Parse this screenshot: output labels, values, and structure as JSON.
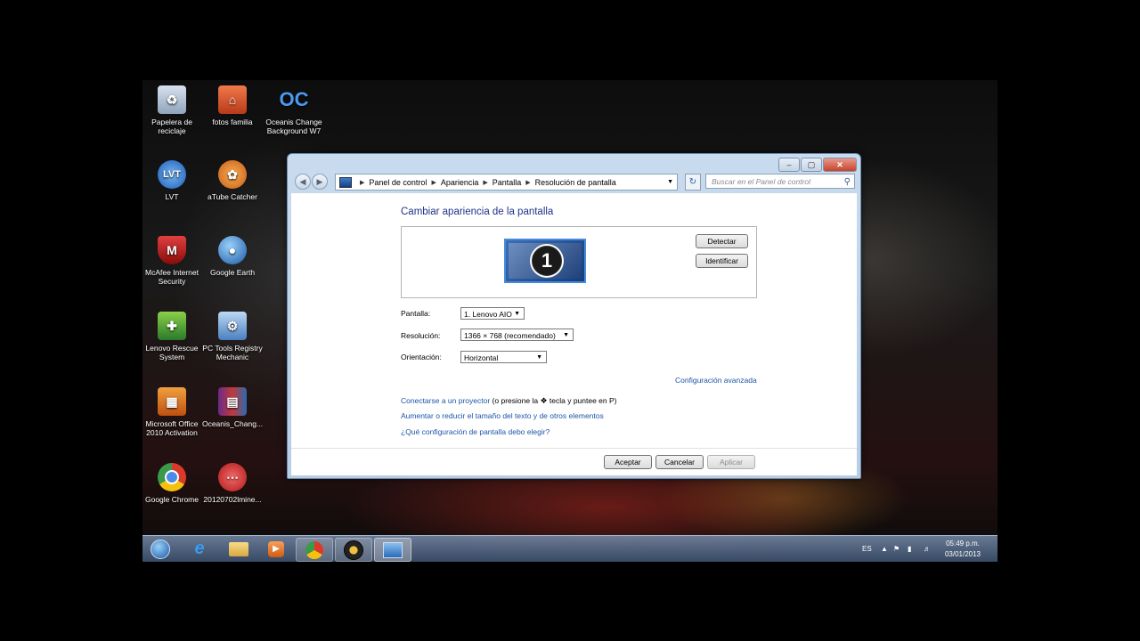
{
  "desktop_icons": [
    {
      "label": "Papelera de reciclaje",
      "icon": "recycle-bin-icon",
      "color": "#9ab0c8"
    },
    {
      "label": "fotos familia",
      "icon": "folder-home-icon",
      "color": "#d24a2a"
    },
    {
      "label": "Oceanis Change Background W7",
      "icon": "oceanis-icon",
      "color": "#3a7bd5"
    },
    {
      "label": "LVT",
      "icon": "lvt-icon",
      "color": "#2a6ec8"
    },
    {
      "label": "aTube Catcher",
      "icon": "atube-catcher-icon",
      "color": "#e07a1a"
    },
    {
      "label": "McAfee Internet Security",
      "icon": "mcafee-icon",
      "color": "#b01818"
    },
    {
      "label": "Google Earth",
      "icon": "google-earth-icon",
      "color": "#2a7ad0"
    },
    {
      "label": "Lenovo Rescue System",
      "icon": "lenovo-rescue-icon",
      "color": "#3a9a3a"
    },
    {
      "label": "PC Tools Registry Mechanic",
      "icon": "registry-mechanic-icon",
      "color": "#4a8ad0"
    },
    {
      "label": "Microsoft Office 2010 Activation",
      "icon": "office-activation-icon",
      "color": "#e08020"
    },
    {
      "label": "Oceanis_Chang...",
      "icon": "winrar-icon",
      "color": "#8a3a9a"
    },
    {
      "label": "Google Chrome",
      "icon": "chrome-icon",
      "color": "#d8322a"
    },
    {
      "label": "20120702lmine...",
      "icon": "lmine-icon",
      "color": "#d02828"
    }
  ],
  "window": {
    "breadcrumb": [
      "Panel de control",
      "Apariencia",
      "Pantalla",
      "Resolución de pantalla"
    ],
    "search_placeholder": "Buscar en el Panel de control",
    "heading": "Cambiar apariencia de la pantalla",
    "monitor_number": "1",
    "detect_button": "Detectar",
    "identify_button": "Identificar",
    "display_label": "Pantalla:",
    "display_value": "1. Lenovo AIO",
    "resolution_label": "Resolución:",
    "resolution_value": "1366 × 768 (recomendado)",
    "orientation_label": "Orientación:",
    "orientation_value": "Horizontal",
    "advanced_link": "Configuración avanzada",
    "projector_link": "Conectarse a un proyector",
    "projector_text_before": "(o presione la",
    "projector_text_after": "tecla y puntee en P)",
    "text_size_link": "Aumentar o reducir el tamaño del texto y de otros elementos",
    "which_settings_link": "¿Qué configuración de pantalla debo elegir?",
    "ok_button": "Aceptar",
    "cancel_button": "Cancelar",
    "apply_button": "Aplicar"
  },
  "taskbar": {
    "items": [
      "start-orb-icon",
      "internet-explorer-icon",
      "explorer-folder-icon",
      "media-player-icon",
      "chrome-icon",
      "music-player-icon",
      "control-panel-icon"
    ],
    "language": "ES",
    "time": "05:49 p.m.",
    "date": "03/01/2013"
  }
}
